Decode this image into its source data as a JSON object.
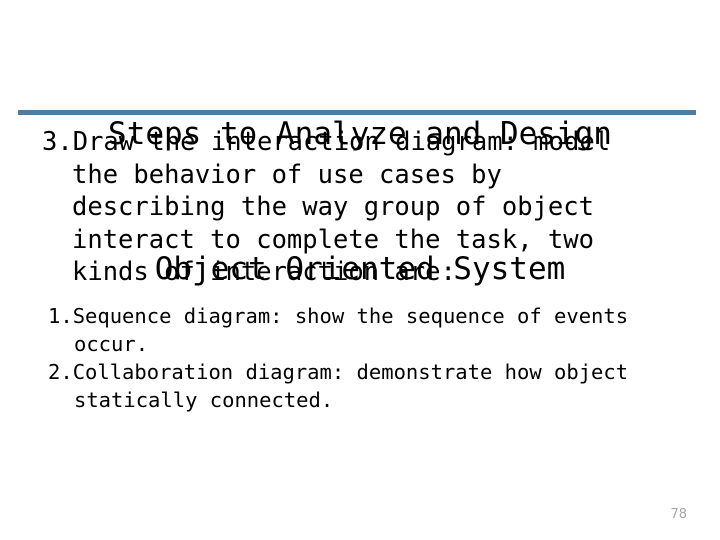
{
  "slide": {
    "title": {
      "line1": "Steps to Analyze and Design",
      "line2": "Object Oriented System"
    },
    "divider_color": "#4e7da4",
    "body": {
      "main_item": {
        "marker": "3.",
        "text": "Draw the interaction diagram: model the behavior of use cases by describing the way group of object interact to complete the task, two kinds of interaction are:"
      },
      "sub_items": [
        {
          "marker": "1.",
          "text": "Sequence diagram: show the sequence of events occur."
        },
        {
          "marker": "2.",
          "text": "Collaboration diagram: demonstrate how object statically connected."
        }
      ]
    },
    "page_number": "78"
  }
}
